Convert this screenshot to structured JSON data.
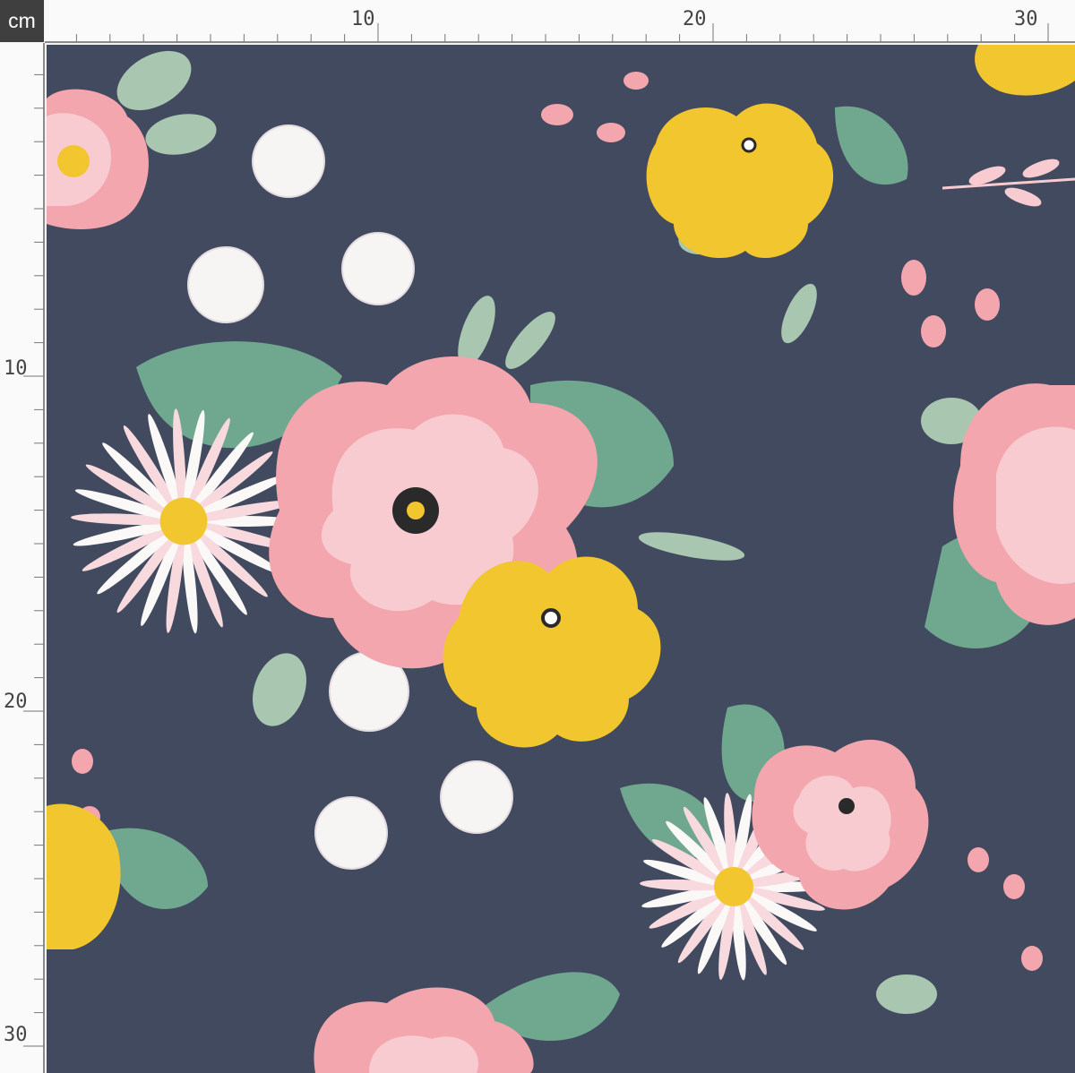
{
  "ruler": {
    "unit": "cm",
    "top_labels": [
      "10",
      "20",
      "30"
    ],
    "left_labels": [
      "10",
      "20",
      "30"
    ]
  },
  "fabric": {
    "background_color": "#414a5f",
    "palette": {
      "pink": "#f3a6ad",
      "light_pink": "#f8cbd1",
      "yellow": "#f2c62f",
      "sage": "#a9c6b0",
      "green": "#6fa88f",
      "white": "#f7f4f4"
    }
  }
}
